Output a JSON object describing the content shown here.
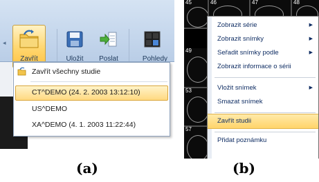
{
  "panel_a": {
    "toolbar": {
      "close_label": "Zavřít",
      "save_label": "Uložit",
      "send_label": "Poslat",
      "views_label": "Pohledy"
    },
    "menu": {
      "close_all_label": "Zavřít všechny studie",
      "studies": [
        {
          "label": "CT^DEMO (24. 2. 2003 13:12:10)",
          "highlighted": true
        },
        {
          "label": "US^DEMO",
          "highlighted": false
        },
        {
          "label": "XA^DEMO (4. 1. 2003 11:22:44)",
          "highlighted": false
        }
      ]
    },
    "caption": "(a)"
  },
  "panel_b": {
    "thumbnail_numbers": [
      "45",
      "46",
      "47",
      "48",
      "49",
      "53",
      "57"
    ],
    "menu": {
      "items": [
        {
          "label": "Zobrazit série",
          "submenu": true
        },
        {
          "label": "Zobrazit snímky",
          "submenu": true
        },
        {
          "label": "Seřadit snímky podle",
          "submenu": true
        },
        {
          "label": "Zobrazit informace o sérii",
          "submenu": false
        },
        {
          "label": "Vložit snímek",
          "submenu": true
        },
        {
          "label": "Smazat snímek",
          "submenu": false
        },
        {
          "label": "Zavřít studii",
          "submenu": false,
          "highlighted": true
        },
        {
          "label": "Přidat poznámku",
          "submenu": false
        }
      ]
    },
    "caption": "(b)"
  },
  "colors": {
    "ribbon": "#c4d6ec",
    "highlight": "#ffd981",
    "menu_text_b": "#0f2d63"
  }
}
